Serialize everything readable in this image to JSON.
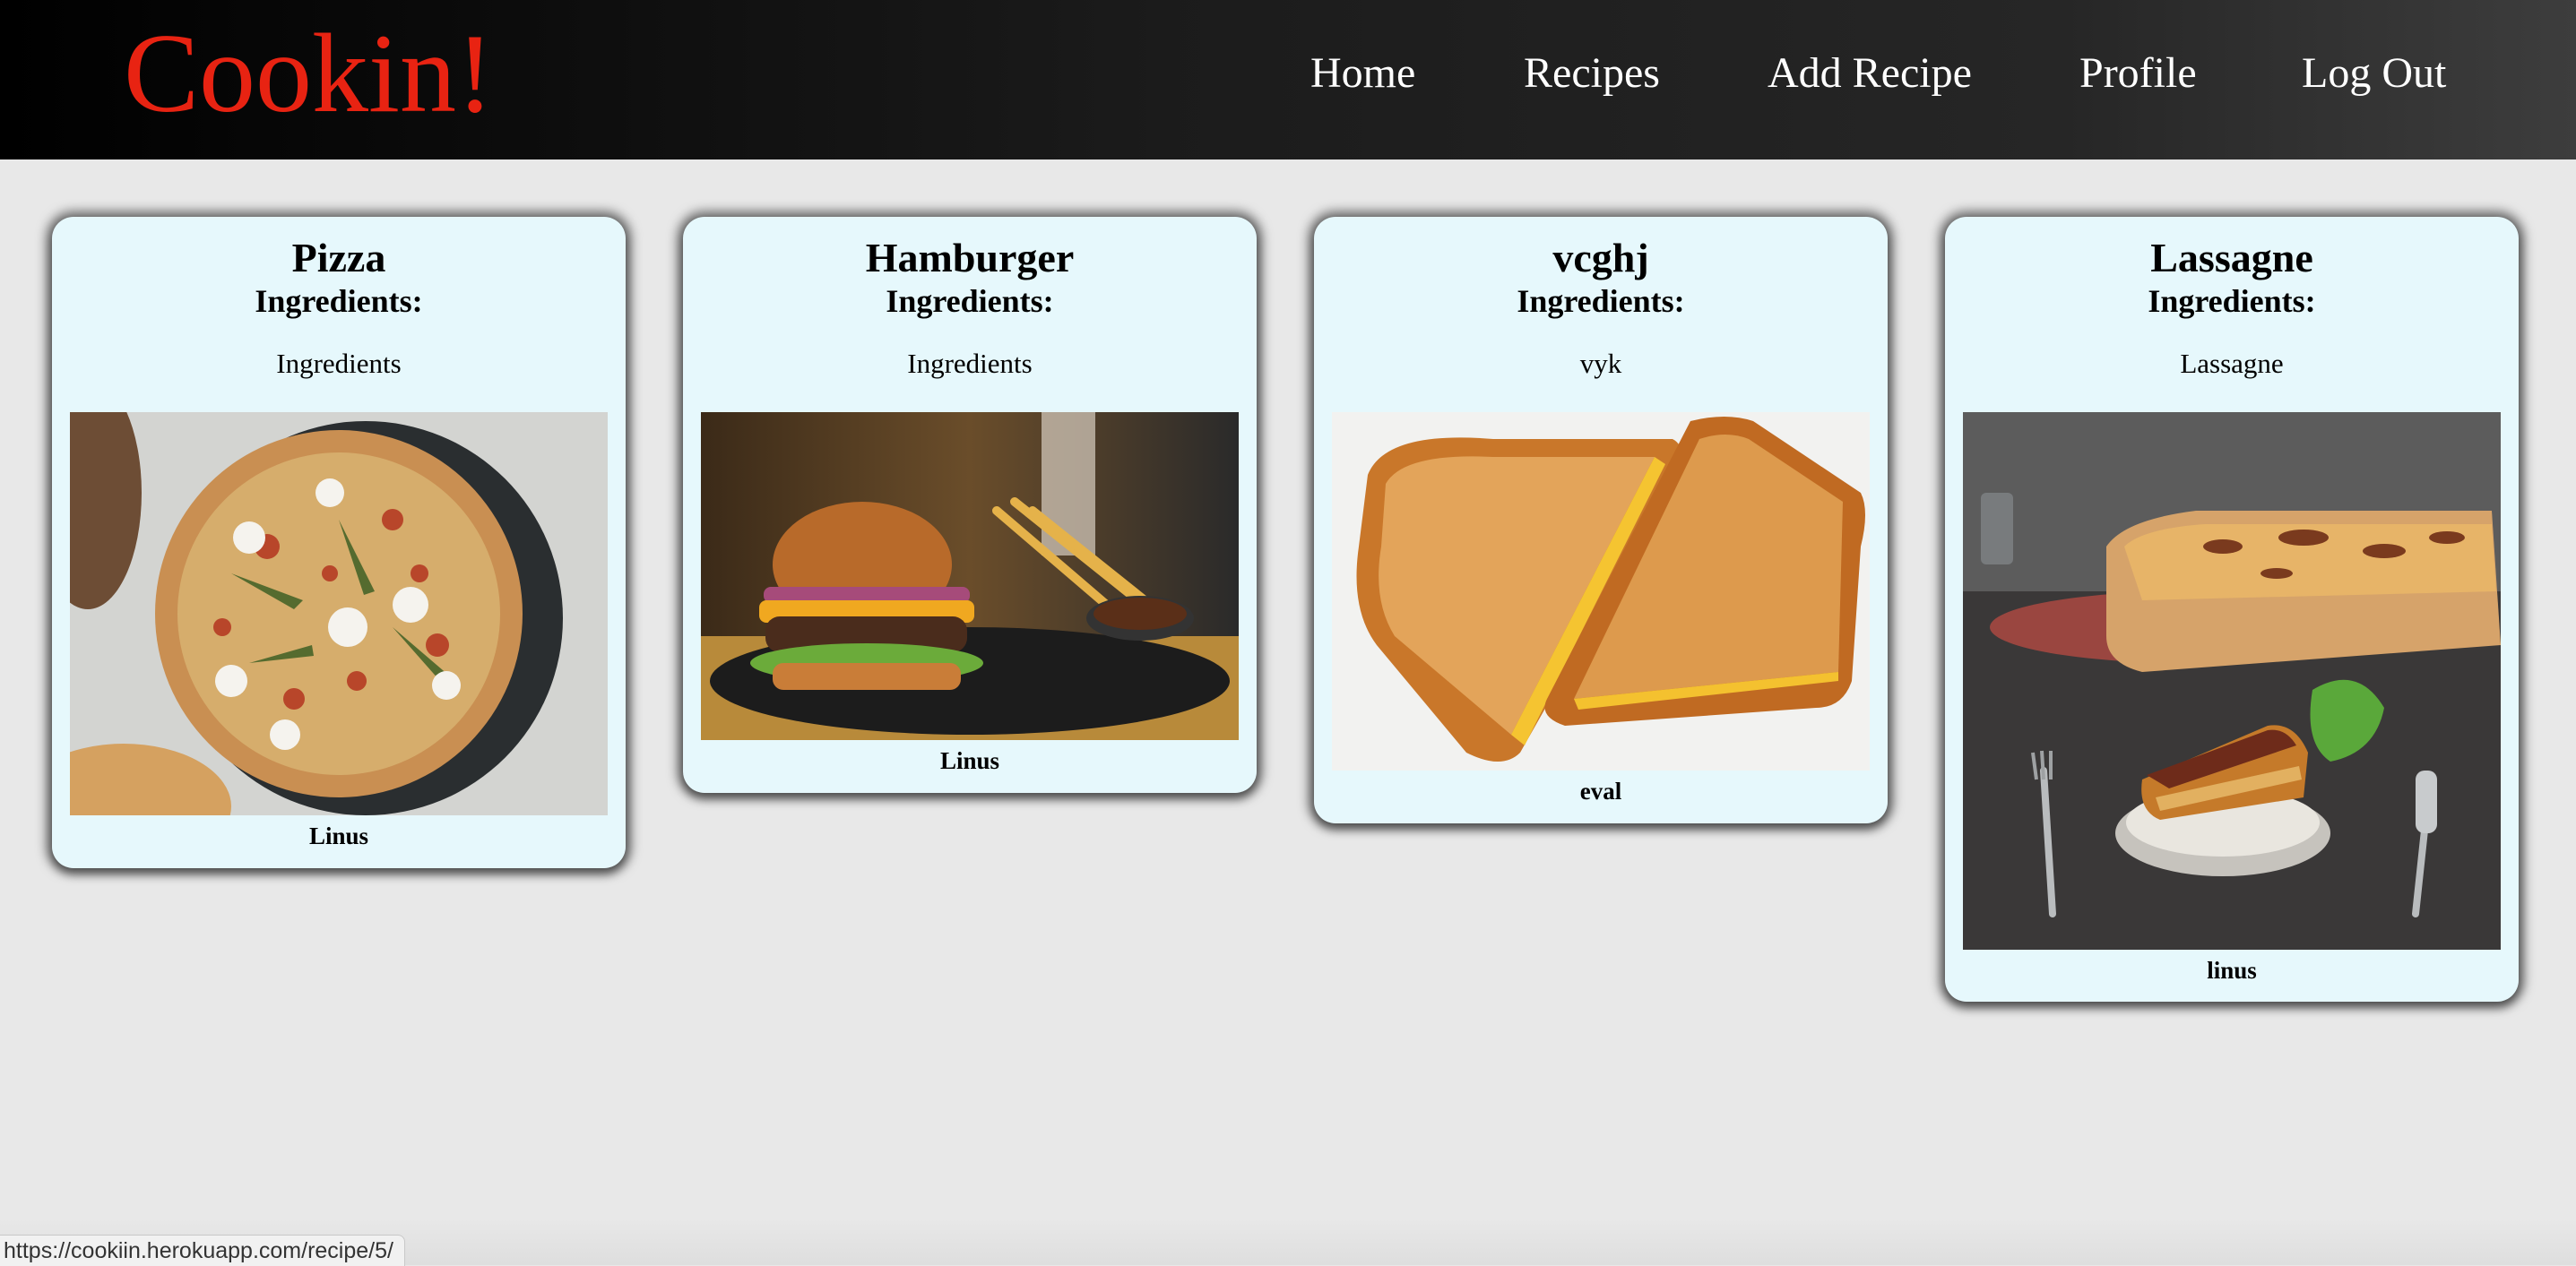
{
  "app": {
    "brand": "Cookin!",
    "brand_color": "#e82312"
  },
  "nav": {
    "items": [
      {
        "label": "Home"
      },
      {
        "label": "Recipes"
      },
      {
        "label": "Add Recipe"
      },
      {
        "label": "Profile"
      },
      {
        "label": "Log Out"
      }
    ]
  },
  "recipes": [
    {
      "title": "Pizza",
      "ingredients_heading": "Ingredients:",
      "ingredients": "Ingredients",
      "author": "Linus",
      "image": "pizza-photo"
    },
    {
      "title": "Hamburger",
      "ingredients_heading": "Ingredients:",
      "ingredients": "Ingredients",
      "author": "Linus",
      "image": "hamburger-photo"
    },
    {
      "title": "vcghj",
      "ingredients_heading": "Ingredients:",
      "ingredients": "vyk",
      "author": "eval",
      "image": "grilled-cheese-photo"
    },
    {
      "title": "Lassagne",
      "ingredients_heading": "Ingredients:",
      "ingredients": "Lassagne",
      "author": "linus",
      "image": "lasagne-photo"
    }
  ],
  "status_bar": {
    "url": "https://cookiin.herokuapp.com/recipe/5/"
  },
  "colors": {
    "header_bg": "#111111",
    "card_bg": "#e6f8fc",
    "page_bg": "#e8e8e8"
  }
}
